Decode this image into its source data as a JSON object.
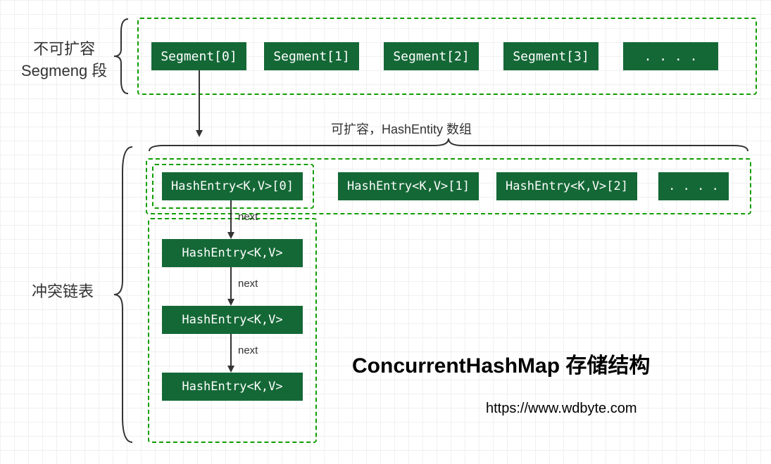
{
  "labels": {
    "segment_label_line1": "不可扩容",
    "segment_label_line2": "Segmeng 段",
    "hashentry_label": "可扩容，HashEntity 数组",
    "conflict_list": "冲突链表",
    "next": "next"
  },
  "segments": [
    "Segment[0]",
    "Segment[1]",
    "Segment[2]",
    "Segment[3]",
    ". . . ."
  ],
  "hash_entries": [
    "HashEntry<K,V>[0]",
    "HashEntry<K,V>[1]",
    "HashEntry<K,V>[2]",
    ". . . ."
  ],
  "chain": [
    "HashEntry<K,V>",
    "HashEntry<K,V>",
    "HashEntry<K,V>"
  ],
  "title": "ConcurrentHashMap 存储结构",
  "url": "https://www.wdbyte.com"
}
